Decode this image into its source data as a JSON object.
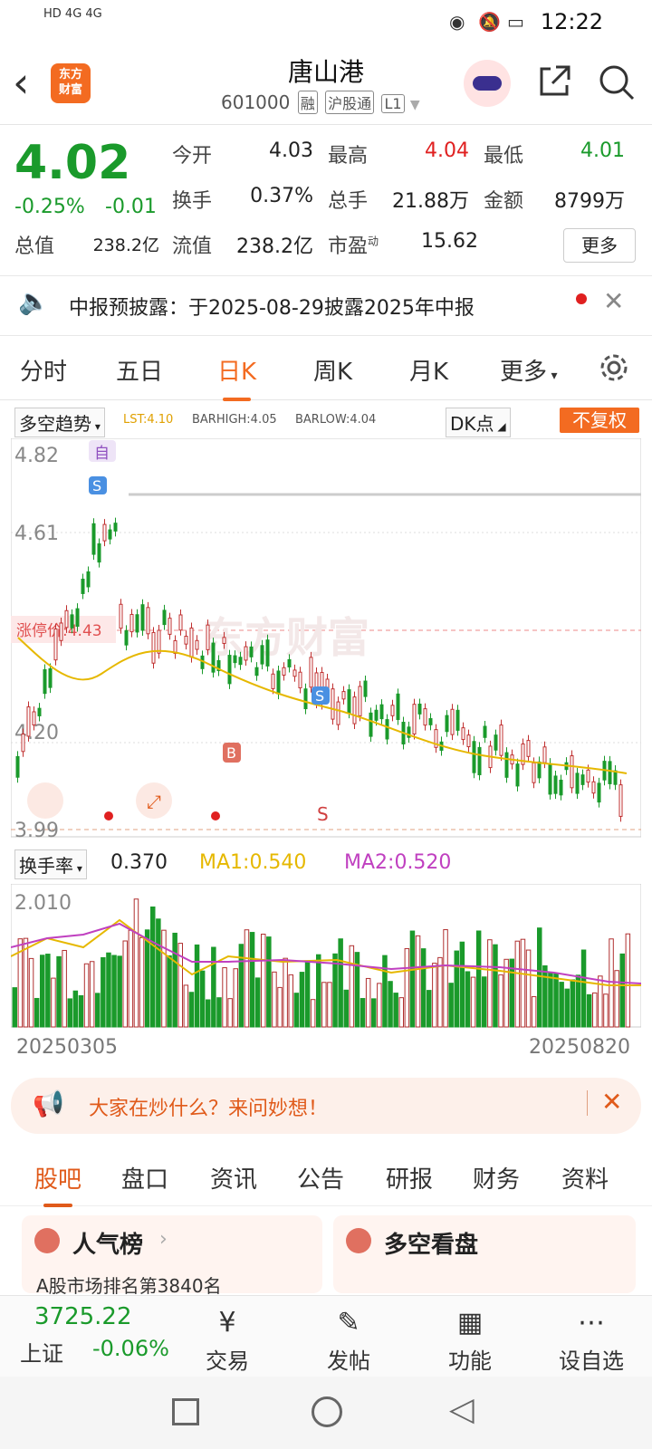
{
  "status_bar": {
    "time": "12:22",
    "network": "HD 4G 4G",
    "colors": {
      "accent": "#f36b21"
    }
  },
  "header": {
    "title": "唐山港",
    "code": "601000",
    "tags": [
      "融",
      "沪股通",
      "L1"
    ]
  },
  "quote": {
    "price": "4.02",
    "change_pct": "-0.25%",
    "change": "-0.01",
    "open_label": "今开",
    "open": "4.03",
    "high_label": "最高",
    "high": "4.04",
    "low_label": "最低",
    "low": "4.01",
    "turnover_label": "换手",
    "turnover": "0.37%",
    "volume_label": "总手",
    "volume": "21.88万",
    "amount_label": "金额",
    "amount": "8799万",
    "mktcap_label": "总值",
    "mktcap": "238.2亿",
    "float_label": "流值",
    "float": "238.2亿",
    "pe_label": "市盈",
    "pe_sup": "动",
    "pe": "15.62",
    "more": "更多"
  },
  "notice": {
    "text": "中报预披露：于2025-08-29披露2025年中报"
  },
  "kline_tabs": [
    "分时",
    "五日",
    "日K",
    "周K",
    "月K",
    "更多"
  ],
  "indicator": {
    "select": "多空趋势",
    "lst": "LST:4.10",
    "barhigh": "BARHIGH:4.05",
    "barlow": "BARLOW:4.04",
    "dk": "DK点",
    "fq": "不复权"
  },
  "chart_data": {
    "type": "candlestick",
    "y_ticks": [
      "4.82",
      "4.61",
      "4.20",
      "3.99"
    ],
    "limit_label": "涨停价:4.43",
    "markers": [
      "自",
      "S",
      "S",
      "B",
      "S"
    ],
    "watermark": "东方财富",
    "volume_indicator": "换手率",
    "volume_value": "0.370",
    "ma1": "MA1:0.540",
    "ma2": "MA2:0.520",
    "volume_tick": "2.010",
    "start_date": "20250305",
    "end_date": "20250820"
  },
  "banner": {
    "text": "大家在炒什么？来问妙想！"
  },
  "feature_tabs": [
    "股吧",
    "盘口",
    "资讯",
    "公告",
    "研报",
    "财务",
    "资料"
  ],
  "cards": [
    {
      "title": "人气榜",
      "sub": "A股市场排名第3840名"
    },
    {
      "title": "多空看盘",
      "sub": ""
    }
  ],
  "bottom_nav": {
    "index_value": "3725.22",
    "index_name": "上证",
    "index_change": "-0.06%",
    "items": [
      "交易",
      "发帖",
      "功能",
      "设自选"
    ]
  }
}
